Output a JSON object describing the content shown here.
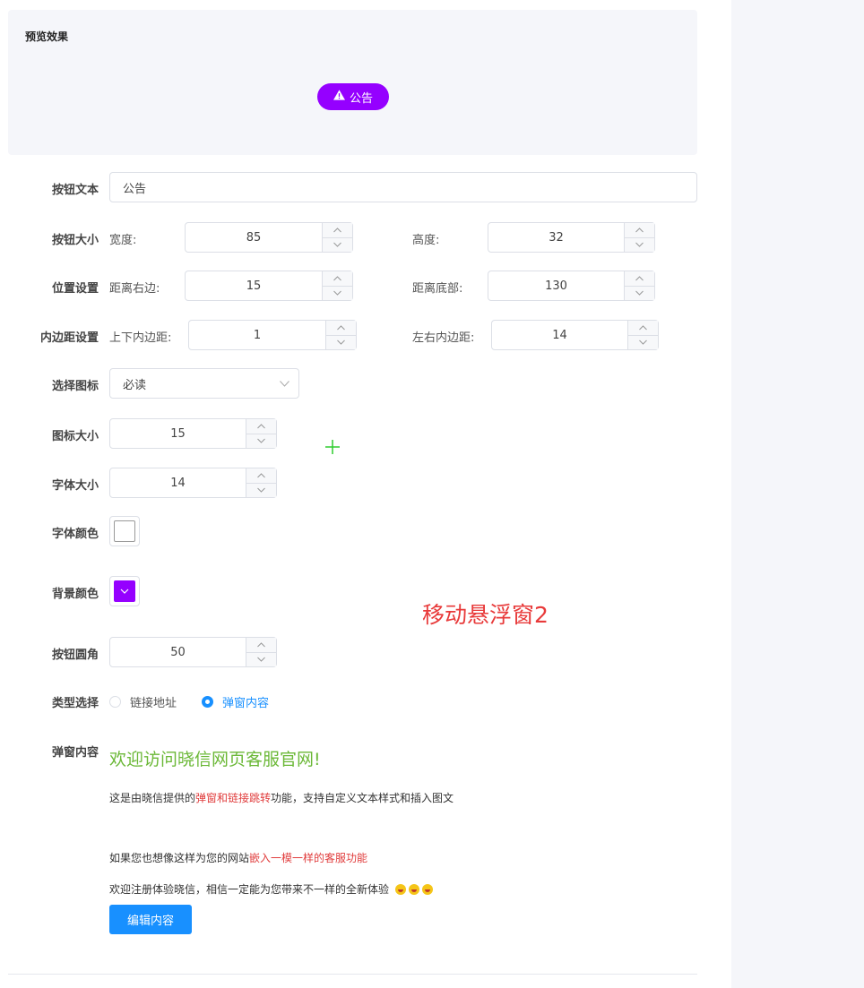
{
  "preview": {
    "title": "预览效果",
    "button_label": "公告",
    "button_bg": "#9500ff",
    "button_icon": "warning-icon"
  },
  "form": {
    "button_text": {
      "label": "按钮文本",
      "value": "公告"
    },
    "button_size": {
      "label": "按钮大小",
      "width_label": "宽度:",
      "width": "85",
      "height_label": "高度:",
      "height": "32"
    },
    "position": {
      "label": "位置设置",
      "right_label": "距离右边:",
      "right": "15",
      "bottom_label": "距离底部:",
      "bottom": "130"
    },
    "padding": {
      "label": "内边距设置",
      "vertical_label": "上下内边距:",
      "vertical": "1",
      "horizontal_label": "左右内边距:",
      "horizontal": "14"
    },
    "icon_select": {
      "label": "选择图标",
      "value": "必读"
    },
    "icon_size": {
      "label": "图标大小",
      "value": "15"
    },
    "font_size": {
      "label": "字体大小",
      "value": "14"
    },
    "font_color": {
      "label": "字体颜色",
      "color": "#ffffff"
    },
    "bg_color": {
      "label": "背景颜色",
      "color": "#9500ff"
    },
    "radius": {
      "label": "按钮圆角",
      "value": "50"
    },
    "type": {
      "label": "类型选择",
      "option_link": "链接地址",
      "option_popup": "弹窗内容",
      "selected": "弹窗内容"
    },
    "popup": {
      "label": "弹窗内容",
      "title": "欢迎访问晓信网页客服官网!",
      "line1_pre": "这是由晓信提供的",
      "line1_red": "弹窗和链接跳转",
      "line1_post": "功能，支持自定义文本样式和插入图文",
      "line2_pre": "如果您也想像这样为您的网站",
      "line2_red": "嵌入一模一样的客服功能",
      "line3": "欢迎注册体验晓信，相信一定能为您带来不一样的全新体验",
      "edit_button": "编辑内容"
    }
  },
  "watermark": "移动悬浮窗2"
}
